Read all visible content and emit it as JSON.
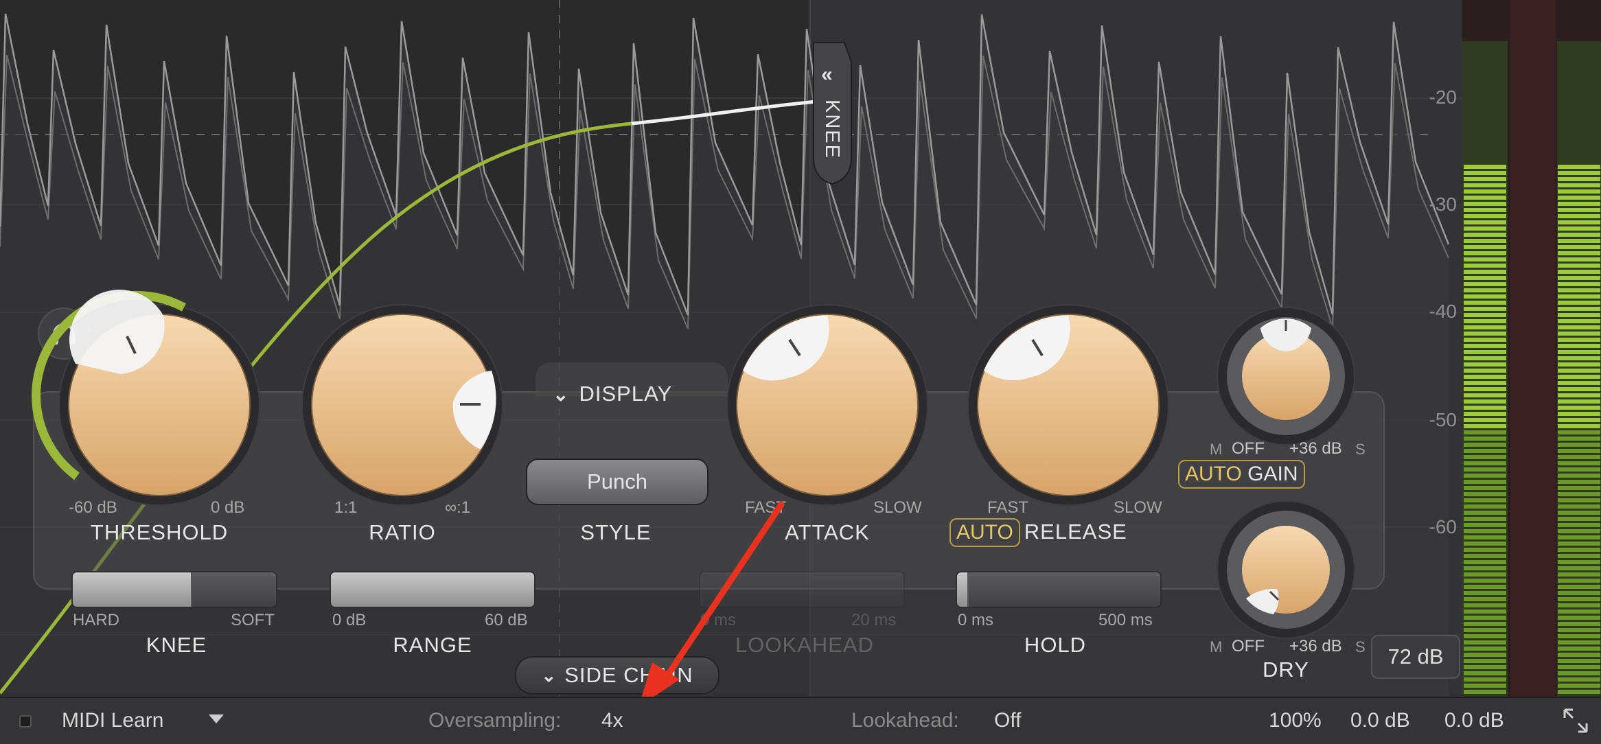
{
  "display": {
    "scale_labels": [
      "-20",
      "-30",
      "-40",
      "-50",
      "-60"
    ],
    "knee_tab_label": "KNEE",
    "display_toggle_label": "DISPLAY",
    "sidechain_toggle_label": "SIDE CHAIN"
  },
  "knobs": {
    "threshold": {
      "label": "THRESHOLD",
      "min_label": "-60 dB",
      "max_label": "0 dB"
    },
    "ratio": {
      "label": "RATIO",
      "min_label": "1:1",
      "max_label": "∞:1"
    },
    "style": {
      "label": "STYLE",
      "value": "Punch"
    },
    "attack": {
      "label": "ATTACK",
      "min_label": "FAST",
      "max_label": "SLOW"
    },
    "release": {
      "label": "RELEASE",
      "auto_prefix": "AUTO",
      "min_label": "FAST",
      "max_label": "SLOW"
    },
    "gain": {
      "label": "GAIN",
      "auto_prefix": "AUTO",
      "min_label": "OFF",
      "max_label": "+36 dB",
      "m_label": "M",
      "s_label": "S"
    },
    "dry": {
      "label": "DRY",
      "min_label": "OFF",
      "max_label": "+36 dB",
      "m_label": "M",
      "s_label": "S"
    }
  },
  "sliders": {
    "knee": {
      "label": "KNEE",
      "min_label": "HARD",
      "max_label": "SOFT",
      "fraction": 0.58
    },
    "range": {
      "label": "RANGE",
      "min_label": "0 dB",
      "max_label": "60 dB",
      "fraction": 1.0
    },
    "lookahead": {
      "label": "LOOKAHEAD",
      "min_label": "0 ms",
      "max_label": "20 ms",
      "fraction": 0.0
    },
    "hold": {
      "label": "HOLD",
      "min_label": "0 ms",
      "max_label": "500 ms",
      "fraction": 0.05
    }
  },
  "meter_range_button": "72 dB",
  "statusbar": {
    "midi_learn": "MIDI Learn",
    "oversampling_label": "Oversampling:",
    "oversampling_value": "4x",
    "lookahead_label": "Lookahead:",
    "lookahead_value": "Off",
    "zoom": "100%",
    "input_gain": "0.0 dB",
    "output_gain": "0.0 dB"
  },
  "colors": {
    "accent_green": "#9bb83a",
    "knob_peach": "#e8b77d",
    "auto_gold": "#e7c76a",
    "arrow_red": "#e8321f"
  },
  "icons": [
    "headphones-icon",
    "chevron-double-left-icon",
    "chevron-double-down-icon",
    "dropdown-triangle-icon",
    "resize-icon"
  ]
}
